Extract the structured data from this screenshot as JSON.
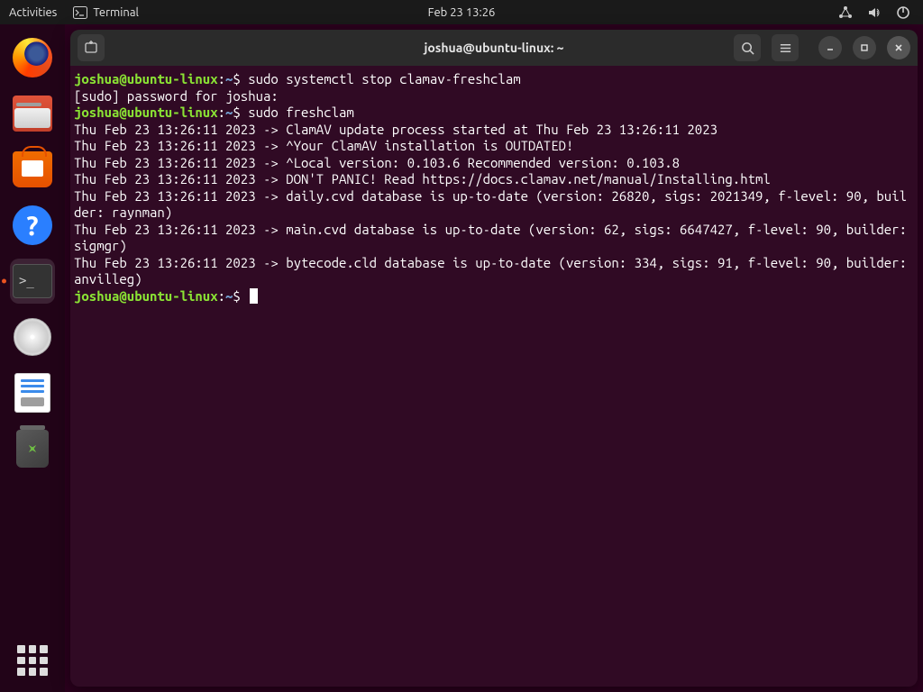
{
  "topbar": {
    "activities": "Activities",
    "app_name": "Terminal",
    "clock": "Feb 23  13:26"
  },
  "dock": {
    "items": [
      {
        "name": "firefox"
      },
      {
        "name": "files"
      },
      {
        "name": "software"
      },
      {
        "name": "help"
      },
      {
        "name": "terminal"
      },
      {
        "name": "disk"
      },
      {
        "name": "text-editor"
      },
      {
        "name": "trash"
      }
    ]
  },
  "window": {
    "title": "joshua@ubuntu-linux: ~"
  },
  "prompt": {
    "user_host": "joshua@ubuntu-linux",
    "sep": ":",
    "path": "~",
    "sigil": "$"
  },
  "terminal": {
    "cmd1": " sudo systemctl stop clamav-freshclam",
    "line2": "[sudo] password for joshua:",
    "cmd2": " sudo freshclam",
    "line4": "Thu Feb 23 13:26:11 2023 -> ClamAV update process started at Thu Feb 23 13:26:11 2023",
    "line5": "Thu Feb 23 13:26:11 2023 -> ^Your ClamAV installation is OUTDATED!",
    "line6": "Thu Feb 23 13:26:11 2023 -> ^Local version: 0.103.6 Recommended version: 0.103.8",
    "line7": "Thu Feb 23 13:26:11 2023 -> DON'T PANIC! Read https://docs.clamav.net/manual/Installing.html",
    "line8": "Thu Feb 23 13:26:11 2023 -> daily.cvd database is up-to-date (version: 26820, sigs: 2021349, f-level: 90, builder: raynman)",
    "line9": "Thu Feb 23 13:26:11 2023 -> main.cvd database is up-to-date (version: 62, sigs: 6647427, f-level: 90, builder: sigmgr)",
    "line10": "Thu Feb 23 13:26:11 2023 -> bytecode.cld database is up-to-date (version: 334, sigs: 91, f-level: 90, builder: anvilleg)"
  }
}
